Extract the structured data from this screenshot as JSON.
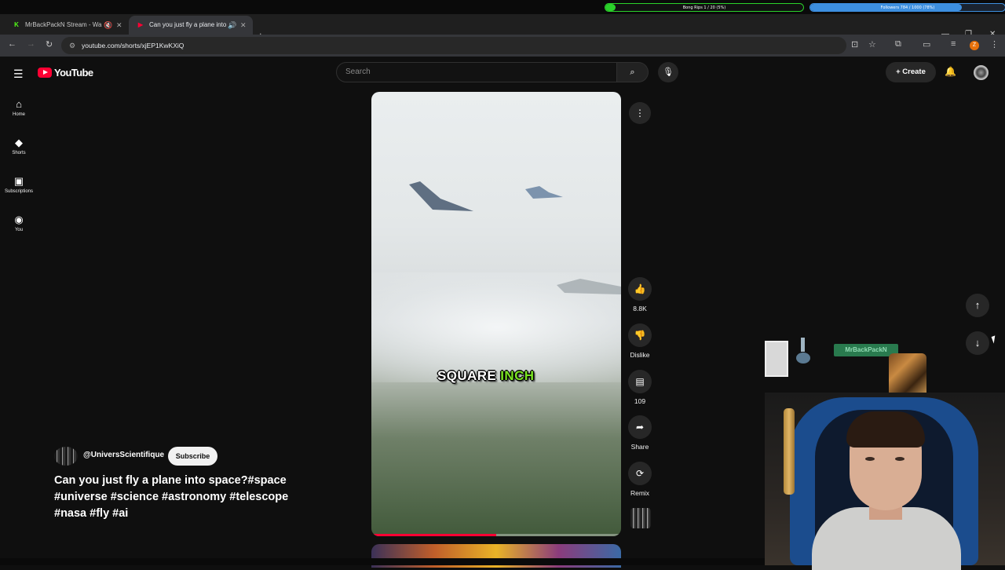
{
  "overlay": {
    "bong_bar": {
      "label": "Bong Rips 1 / 20 (5%)",
      "progress": 0.05,
      "color": "#2ad12a"
    },
    "followers_bar": {
      "label": "Followers 784 / 1000 (78%)",
      "progress": 0.78,
      "color": "#3d8fe0"
    },
    "name_tag": "MrBackPackN"
  },
  "browser": {
    "tabs": [
      {
        "title": "MrBackPackN Stream - Wa",
        "favicon": "K",
        "favicon_color": "#53fc18",
        "active": false
      },
      {
        "title": "Can you just fly a plane into space?",
        "favicon": "▶",
        "favicon_color": "#ff0033",
        "active": true
      }
    ],
    "url": "youtube.com/shorts/xjEP1KwKXiQ",
    "new_tab_label": "+",
    "profile_initial": "Z"
  },
  "youtube": {
    "logo_text": "YouTube",
    "search_placeholder": "Search",
    "create_label": "Create",
    "nav": [
      {
        "icon": "home-icon",
        "glyph": "⌂",
        "label": "Home"
      },
      {
        "icon": "shorts-icon",
        "glyph": "◆",
        "label": "Shorts"
      },
      {
        "icon": "subscriptions-icon",
        "glyph": "▣",
        "label": "Subscriptions"
      },
      {
        "icon": "you-icon",
        "glyph": "◉",
        "label": "You"
      }
    ],
    "short": {
      "caption_word1": "SQUARE",
      "caption_word2": "INCH",
      "caption_highlight_color": "#7ae322",
      "progress": 0.5,
      "channel": "@UniversScientifique",
      "subscribe_label": "Subscribe",
      "title": "Can you just fly a plane into space?#space #universe #science #astronomy #telescope #nasa #fly #ai"
    },
    "actions": [
      {
        "icon": "like-icon",
        "glyph": "👍",
        "label": "8.8K"
      },
      {
        "icon": "dislike-icon",
        "glyph": "👎",
        "label": "Dislike"
      },
      {
        "icon": "comment-icon",
        "glyph": "▤",
        "label": "109"
      },
      {
        "icon": "share-icon",
        "glyph": "➦",
        "label": "Share"
      },
      {
        "icon": "remix-icon",
        "glyph": "⟳",
        "label": "Remix"
      }
    ]
  }
}
